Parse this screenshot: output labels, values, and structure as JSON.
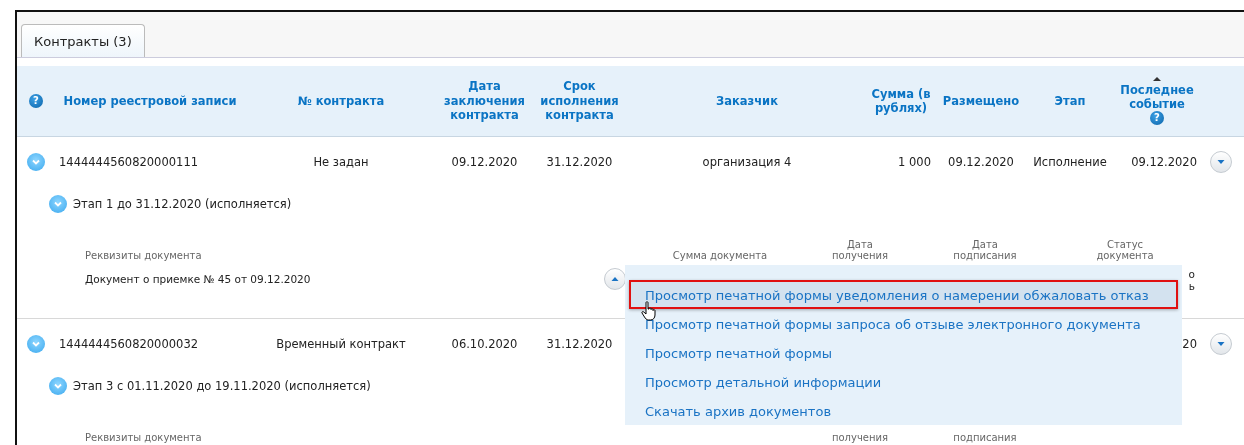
{
  "tabs": [
    {
      "label": "Контракты (3)",
      "selected": true
    }
  ],
  "table": {
    "help_icon": "?",
    "columns": [
      {
        "label": "Номер реестровой записи"
      },
      {
        "label": "№ контракта"
      },
      {
        "label": "Дата заключения контракта"
      },
      {
        "label": "Срок исполнения контракта"
      },
      {
        "label": "Заказчик"
      },
      {
        "label": "Сумма (в рублях)"
      },
      {
        "label": "Размещено"
      },
      {
        "label": "Этап"
      },
      {
        "label": "Последнее событие",
        "sorted": true,
        "help_icon": "?"
      }
    ],
    "contracts": [
      {
        "expanded": true,
        "cells": [
          "1444444560820000111",
          "Не задан",
          "09.12.2020",
          "31.12.2020",
          "организация 4",
          "1 000",
          "09.12.2020",
          "Исполнение",
          "09.12.2020"
        ],
        "stages": [
          {
            "expanded": true,
            "label": "Этап 1 до 31.12.2020 (исполняется)",
            "doc_header": {
              "details": "Реквизиты документа",
              "amount": "Сумма документа",
              "received": "Дата получения",
              "signed": "Дата подписания",
              "status": "Статус документа"
            },
            "documents": [
              {
                "name": "Документ о приемке № 45 от 09.12.2020",
                "menu_open": true,
                "status": [
                  "о",
                  "ь"
                ]
              }
            ]
          }
        ]
      },
      {
        "expanded": true,
        "cells": [
          "1444444560820000032",
          "Временный контракт",
          "06.10.2020",
          "31.12.2020",
          null,
          null,
          null,
          null,
          "20"
        ],
        "stages": [
          {
            "expanded": true,
            "label": "Этап 3 с 01.11.2020 до 19.11.2020 (исполняется)",
            "doc_header": {
              "details": "Реквизиты документа",
              "received": "получения",
              "signed": "подписания"
            }
          }
        ]
      }
    ]
  },
  "context_menu": {
    "items": [
      {
        "label": "Просмотр печатной формы уведомления о намерении обжаловать отказ",
        "selected": true
      },
      {
        "label": "Просмотр печатной формы запроса об отзыве электронного документа",
        "selected": false
      },
      {
        "label": "Просмотр печатной формы",
        "selected": false
      },
      {
        "label": "Просмотр детальной информации",
        "selected": false
      },
      {
        "label": "Скачать архив документов",
        "selected": false
      }
    ]
  }
}
